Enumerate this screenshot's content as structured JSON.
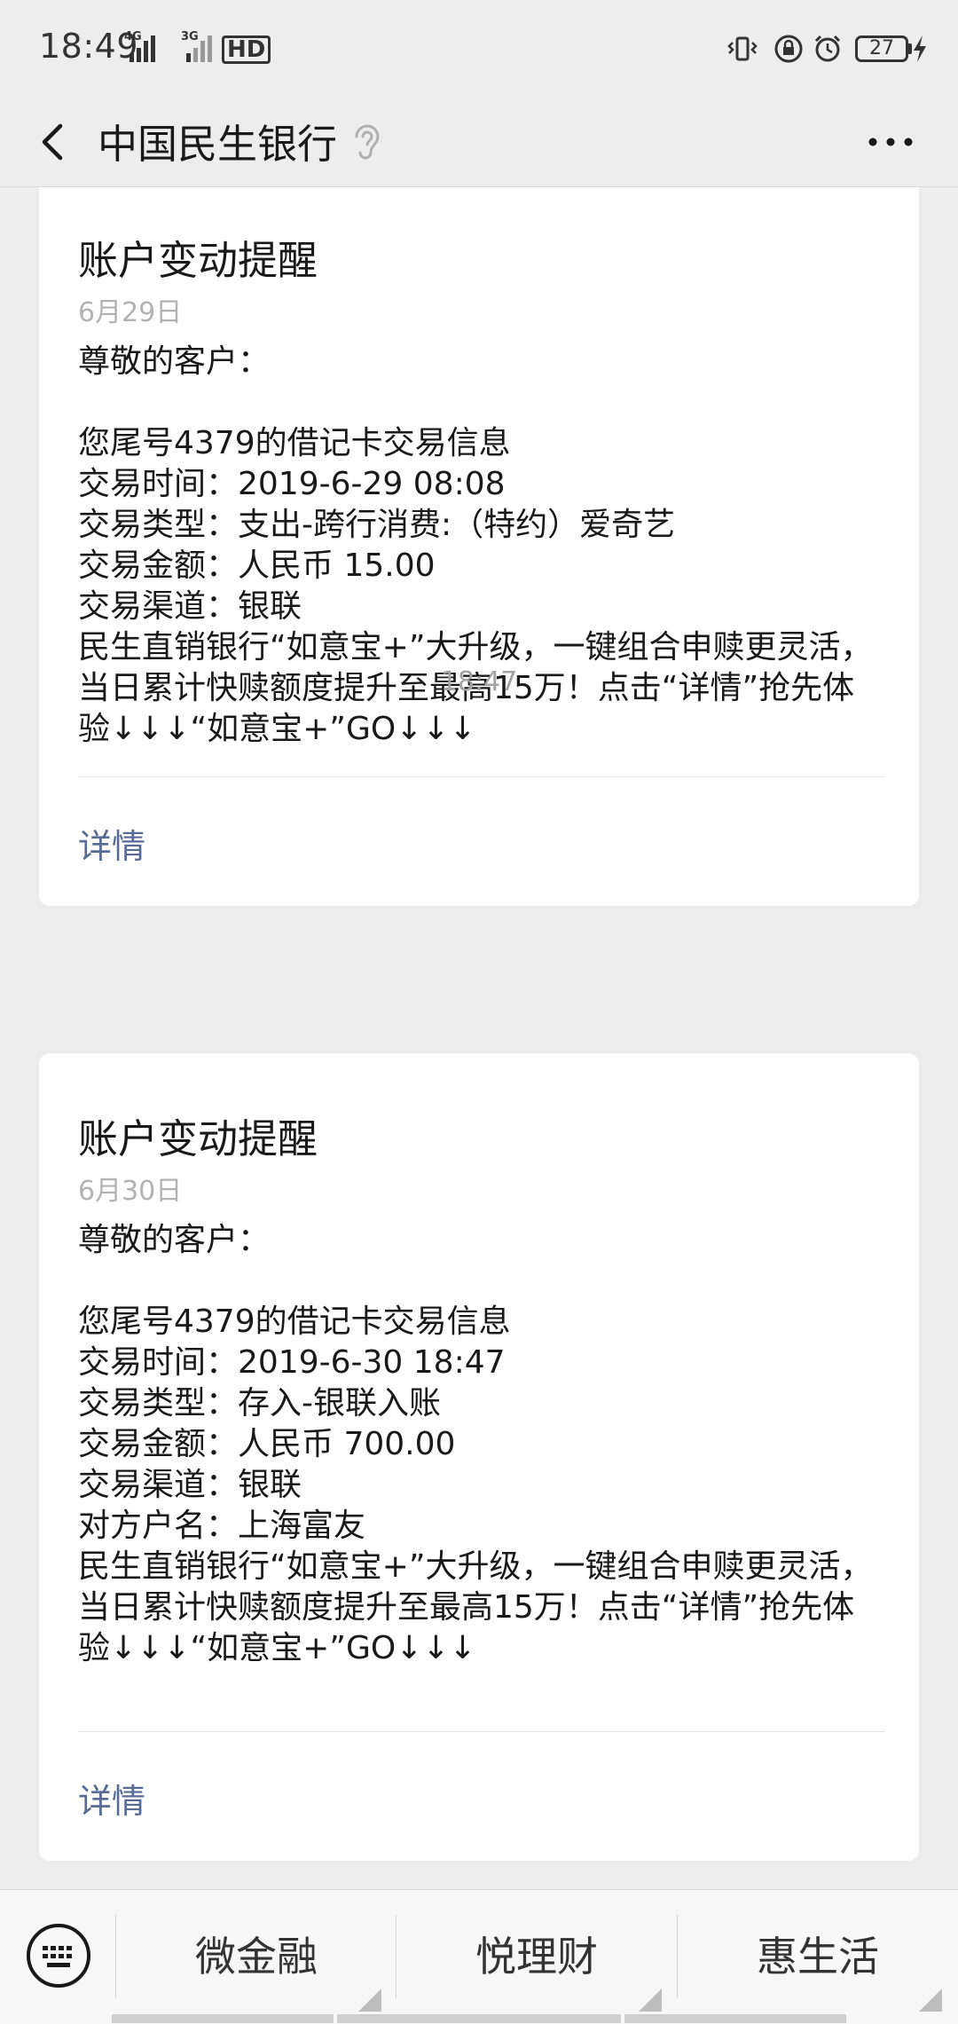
{
  "status_bar": {
    "time": "18:49",
    "signal1_label": "4G",
    "signal2_label": "3G",
    "hd_label": "HD",
    "battery": "27"
  },
  "nav": {
    "title": "中国民生银行"
  },
  "messages": [
    {
      "title": "账户变动提醒",
      "date": "6月29日",
      "greeting": "尊敬的客户：",
      "lines": [
        "您尾号4379的借记卡交易信息",
        "交易时间：2019-6-29 08:08",
        "交易类型：支出-跨行消费:（特约）爱奇艺",
        "交易金额：人民币 15.00",
        "交易渠道：银联",
        "民生直销银行“如意宝+”大升级，一键组合申赎更灵活，",
        "当日累计快赎额度提升至最高15万！点击“详情”抢先体",
        "验↓↓↓“如意宝+”GO↓↓↓"
      ],
      "link": "详情"
    },
    {
      "timestamp": "18:47",
      "title": "账户变动提醒",
      "date": "6月30日",
      "greeting": "尊敬的客户：",
      "lines": [
        "您尾号4379的借记卡交易信息",
        "交易时间：2019-6-30 18:47",
        "交易类型：存入-银联入账",
        "交易金额：人民币 700.00",
        "交易渠道：银联",
        "对方户名：上海富友",
        "民生直销银行“如意宝+”大升级，一键组合申赎更灵活，",
        "当日累计快赎额度提升至最高15万！点击“详情”抢先体",
        "验↓↓↓“如意宝+”GO↓↓↓"
      ],
      "link": "详情"
    }
  ],
  "bottom_menu": {
    "items": [
      "微金融",
      "悦理财",
      "惠生活"
    ]
  },
  "colors": {
    "background": "#ededed",
    "card": "#ffffff",
    "link": "#576b95",
    "muted": "#b2b2b2"
  },
  "icons": [
    "back-arrow-icon",
    "ear-icon",
    "more-icon",
    "keyboard-icon",
    "vibrate-icon",
    "lock-rotation-icon",
    "alarm-icon",
    "battery-icon",
    "charging-icon"
  ]
}
